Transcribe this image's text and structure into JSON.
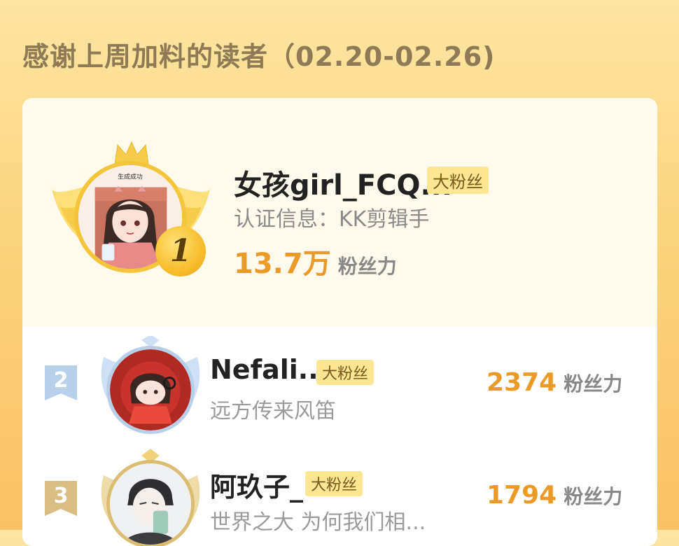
{
  "heading": "感谢上周加料的读者（02.20-02.26)",
  "top_fan": {
    "rank": "1",
    "avatar_caption": "生成成功",
    "name": "女孩girl_FCQ...",
    "badge": "大粉丝",
    "cert": "认证信息：KK剪辑手",
    "fans_value": "13.7万",
    "fans_unit": "粉丝力"
  },
  "fans": [
    {
      "rank": "2",
      "name": "Nefali...",
      "badge": "大粉丝",
      "sub": "远方传来风笛",
      "fans_value": "2374",
      "fans_unit": "粉丝力"
    },
    {
      "rank": "3",
      "name": "阿玖子_",
      "badge": "大粉丝",
      "sub": "世界之大 为何我们相...",
      "fans_value": "1794",
      "fans_unit": "粉丝力"
    }
  ],
  "colors": {
    "accent": "#eb9a27",
    "gold": "#f7be2c",
    "silver": "#b8d0ea",
    "bronze": "#d8be82",
    "badge_bg": "#fde692"
  }
}
